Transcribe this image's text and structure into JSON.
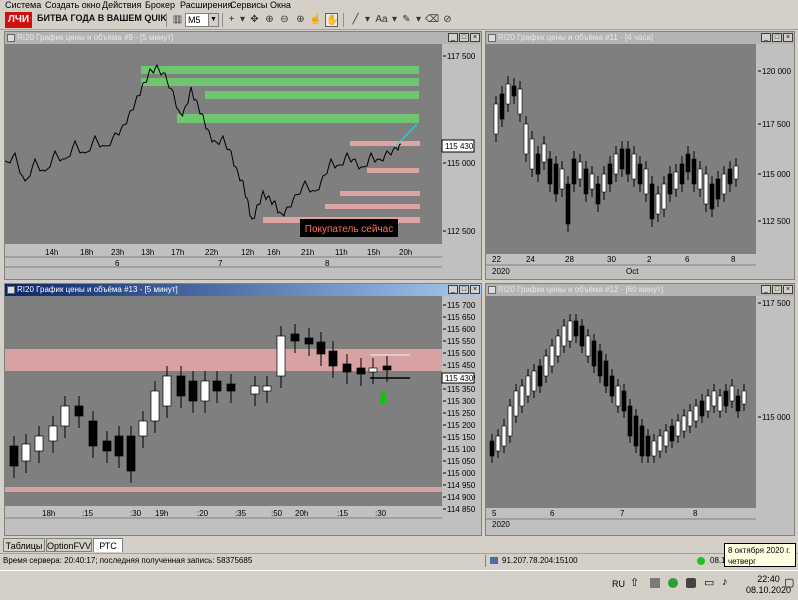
{
  "menu": [
    "Система",
    "Создать окно",
    "Действия",
    "Брокер",
    "Расширения",
    "Сервисы",
    "Окна"
  ],
  "toolbar": {
    "logo": "ЛЧИ",
    "banner": "БИТВА ГОДА В ВАШЕМ QUIK",
    "timeframe": "M5"
  },
  "windows": {
    "w1": {
      "title": "RI20 График цены и объёма #9 - [5 минут]",
      "y_labels": [
        "117 500",
        "115 000",
        "112 500"
      ],
      "price_box": "115 430",
      "x_labels": [
        "14h",
        "18h",
        "23h",
        "13h",
        "17h",
        "22h",
        "12h",
        "16h",
        "21h",
        "11h",
        "15h",
        "20h"
      ],
      "day_labels": [
        "6",
        "7",
        "8"
      ],
      "note": "Покупатель сейчас"
    },
    "w2": {
      "title": "RI20 График цены и объёма #11 - [4 часа]",
      "y_labels": [
        "120 000",
        "117 500",
        "115 000",
        "112 500"
      ],
      "x_labels": [
        "22",
        "24",
        "28",
        "30",
        "2",
        "6",
        "8"
      ],
      "bottom_labels": [
        "2020",
        "Oct"
      ]
    },
    "w3": {
      "title": "RI20 График цены и объёма #13 - [5 минут]",
      "y_labels": [
        "115 700",
        "115 650",
        "115 600",
        "115 550",
        "115 500",
        "115 450",
        "115 400",
        "115 350",
        "115 300",
        "115 250",
        "115 200",
        "115 150",
        "115 100",
        "115 050",
        "115 000",
        "114 950",
        "114 900",
        "114 850"
      ],
      "price_box": "115 430",
      "x_labels": [
        "18h",
        ":15",
        ":30",
        "19h",
        ":20",
        ":35",
        ":50",
        "20h",
        ":15",
        ":30"
      ]
    },
    "w4": {
      "title": "RI20 График цены и объёма #12 - [60 минут]",
      "y_labels": [
        "117 500",
        "115 000"
      ],
      "x_labels": [
        "5",
        "6",
        "7",
        "8"
      ],
      "bottom_labels": [
        "2020"
      ]
    }
  },
  "tabs": [
    "Таблицы",
    "OptionFVV",
    "РТС"
  ],
  "status": {
    "left": "Время сервера: 20:40:17; последняя полученная запись: 58375685",
    "connection": "91.207.78.204:15100",
    "time": "08.1"
  },
  "tooltip": {
    "line1": "8 октября 2020 г.",
    "line2": "четверг"
  },
  "taskbar": {
    "lang": "RU",
    "clock": "22:40",
    "date": "08.10.2020"
  }
}
